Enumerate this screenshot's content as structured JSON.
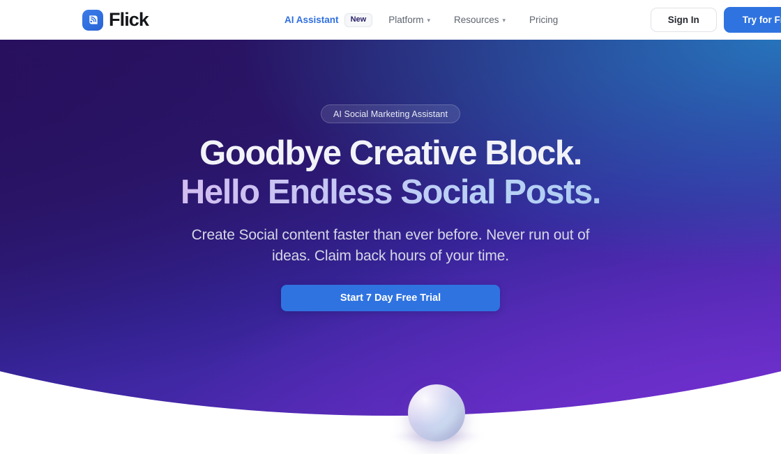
{
  "brand": {
    "name": "Flick",
    "logo_icon": "broadcast-rss-icon",
    "logo_color": "#2f6fe0"
  },
  "header": {
    "nav": [
      {
        "label": "AI Assistant",
        "badge": "New",
        "has_dropdown": false,
        "active": true
      },
      {
        "label": "Platform",
        "has_dropdown": true,
        "active": false
      },
      {
        "label": "Resources",
        "has_dropdown": true,
        "active": false
      },
      {
        "label": "Pricing",
        "has_dropdown": false,
        "active": false
      }
    ],
    "sign_in_label": "Sign In",
    "try_free_label": "Try for Free",
    "chevron_icon": "chevron-down-icon"
  },
  "hero": {
    "pill_label": "AI Social Marketing Assistant",
    "headline_line1": "Goodbye Creative Block.",
    "headline_line2": "Hello Endless Social Posts.",
    "subtitle": "Create Social content faster than ever before. Never run out of ideas. Claim back hours of your time.",
    "cta_label": "Start 7 Day Free Trial",
    "gradient_from": "#2a1360",
    "gradient_mid": "#36259a",
    "gradient_to": "#5a2dc0",
    "accent_blue": "#2f73e0",
    "orb_label": "decorative-sphere"
  }
}
